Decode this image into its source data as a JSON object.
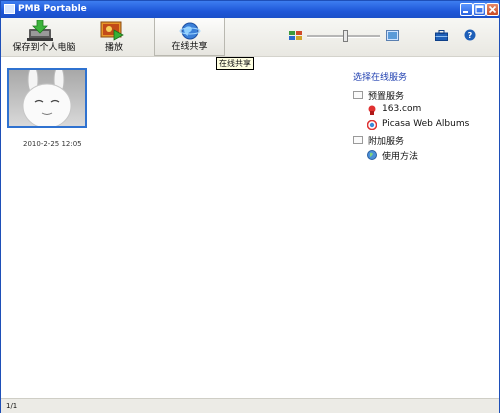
{
  "window": {
    "title": "PMB Portable"
  },
  "toolbar": {
    "save_label": "保存到个人电脑",
    "play_label": "播放",
    "share_label": "在线共享"
  },
  "tooltip": {
    "text": "在线共享"
  },
  "photo": {
    "date": "2010-2-25 12:05"
  },
  "services": {
    "heading": "选择在线服务",
    "preset_group": "预置服务",
    "item_163": "163.com",
    "item_picasa": "Picasa Web Albums",
    "addon_group": "附加服务",
    "item_howto": "使用方法"
  },
  "status": {
    "page": "1/1"
  }
}
